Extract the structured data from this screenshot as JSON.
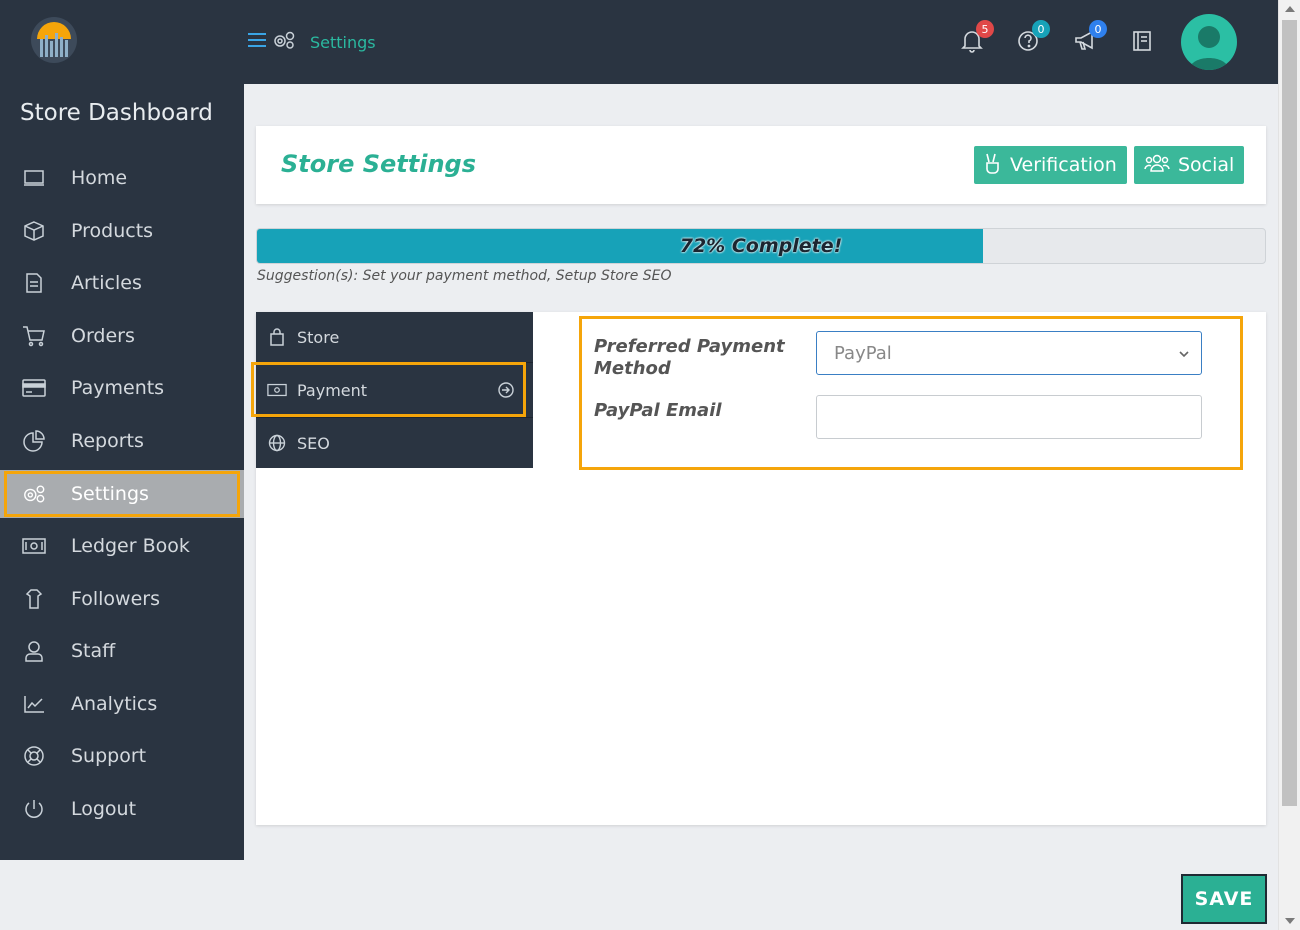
{
  "topbar": {
    "breadcrumb_label": "Settings",
    "notifications_count": "5",
    "help_count": "0",
    "announcements_count": "0",
    "colors": {
      "background": "#2a3441",
      "accent": "#2bb9a0",
      "badge_red": "#e04848",
      "badge_teal": "#17a2b8",
      "badge_blue": "#2f80ed"
    }
  },
  "sidebar": {
    "title": "Store Dashboard",
    "items": [
      {
        "label": "Home",
        "icon": "monitor-icon"
      },
      {
        "label": "Products",
        "icon": "box-icon"
      },
      {
        "label": "Articles",
        "icon": "document-icon"
      },
      {
        "label": "Orders",
        "icon": "cart-icon"
      },
      {
        "label": "Payments",
        "icon": "credit-card-icon"
      },
      {
        "label": "Reports",
        "icon": "pie-chart-icon"
      },
      {
        "label": "Settings",
        "icon": "gears-icon",
        "active": true
      },
      {
        "label": "Ledger Book",
        "icon": "money-icon"
      },
      {
        "label": "Followers",
        "icon": "shirt-icon"
      },
      {
        "label": "Staff",
        "icon": "user-icon"
      },
      {
        "label": "Analytics",
        "icon": "line-chart-icon"
      },
      {
        "label": "Support",
        "icon": "lifebuoy-icon"
      },
      {
        "label": "Logout",
        "icon": "power-icon"
      }
    ]
  },
  "header": {
    "title": "Store Settings",
    "verification_label": "Verification",
    "social_label": "Social"
  },
  "progress": {
    "value": 0.72,
    "label": "72% Complete!",
    "suggestion": "Suggestion(s): Set your payment method, Setup Store SEO"
  },
  "tabs": [
    {
      "label": "Store",
      "icon": "bag-icon"
    },
    {
      "label": "Payment",
      "icon": "money-icon",
      "active": true
    },
    {
      "label": "SEO",
      "icon": "globe-icon"
    }
  ],
  "form": {
    "payment_method_label": "Preferred Payment Method",
    "payment_method_value": "PayPal",
    "paypal_email_label": "PayPal Email",
    "paypal_email_value": ""
  },
  "save_label": "SAVE"
}
